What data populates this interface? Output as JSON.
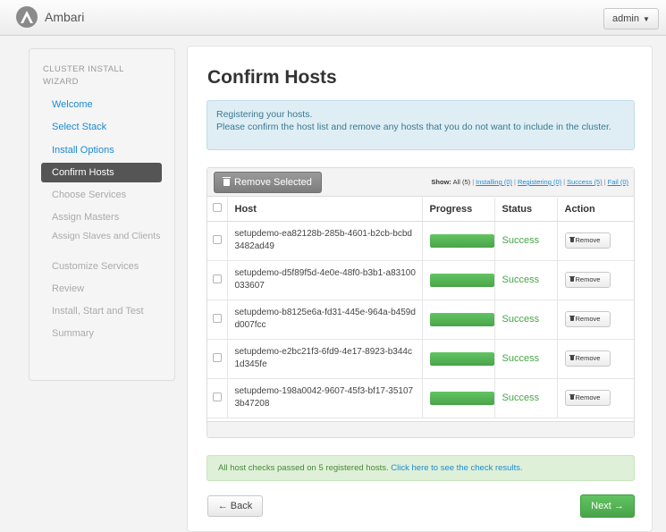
{
  "navbar": {
    "brand": "Ambari",
    "user_menu": "admin",
    "caret": "▼"
  },
  "sidebar": {
    "title": "CLUSTER INSTALL WIZARD",
    "steps": [
      {
        "label": "Welcome",
        "state": "done"
      },
      {
        "label": "Select Stack",
        "state": "done"
      },
      {
        "label": "Install Options",
        "state": "done"
      },
      {
        "label": "Confirm Hosts",
        "state": "active"
      },
      {
        "label": "Choose Services",
        "state": "todo"
      },
      {
        "label": "Assign Masters",
        "state": "todo"
      },
      {
        "label": "Assign Slaves and Clients",
        "state": "todo"
      },
      {
        "label": "Customize Services",
        "state": "todo"
      },
      {
        "label": "Review",
        "state": "todo"
      },
      {
        "label": "Install, Start and Test",
        "state": "todo"
      },
      {
        "label": "Summary",
        "state": "todo"
      }
    ]
  },
  "main": {
    "title": "Confirm Hosts",
    "info_line1": "Registering your hosts.",
    "info_line2": "Please confirm the host list and remove any hosts that you do not want to include in the cluster.",
    "remove_selected": "Remove Selected",
    "filters": {
      "show_label": "Show:",
      "all": "All (5)",
      "installing": "Installing (0)",
      "registering": "Registering (0)",
      "success": "Success (5)",
      "fail": "Fail (0)",
      "separator": "|"
    },
    "table": {
      "headers": [
        "Host",
        "Progress",
        "Status",
        "Action"
      ],
      "rows": [
        {
          "host": "setupdemo-ea82128b-285b-4601-b2cb-bcbd3482ad49",
          "progress": 100,
          "status": "Success",
          "action": "Remove"
        },
        {
          "host": "setupdemo-d5f89f5d-4e0e-48f0-b3b1-a83100033607",
          "progress": 100,
          "status": "Success",
          "action": "Remove"
        },
        {
          "host": "setupdemo-b8125e6a-fd31-445e-964a-b459dd007fcc",
          "progress": 100,
          "status": "Success",
          "action": "Remove"
        },
        {
          "host": "setupdemo-e2bc21f3-6fd9-4e17-8923-b344c1d345fe",
          "progress": 100,
          "status": "Success",
          "action": "Remove"
        },
        {
          "host": "setupdemo-198a0042-9607-45f3-bf17-351073b47208",
          "progress": 100,
          "status": "Success",
          "action": "Remove"
        }
      ]
    },
    "alert_text": "All host checks passed on 5 registered hosts.",
    "alert_link": "Click here to see the check results.",
    "back_button": "← Back",
    "next_button": "Next →"
  },
  "colors": {
    "link": "#1d8bd1",
    "success": "#46a546",
    "active_step": "#555555",
    "info_bg": "#dfeef4",
    "alert_bg": "#dff0d8"
  },
  "icons": [
    "ambari-logo-icon",
    "trash-icon",
    "chevron-down-icon"
  ]
}
